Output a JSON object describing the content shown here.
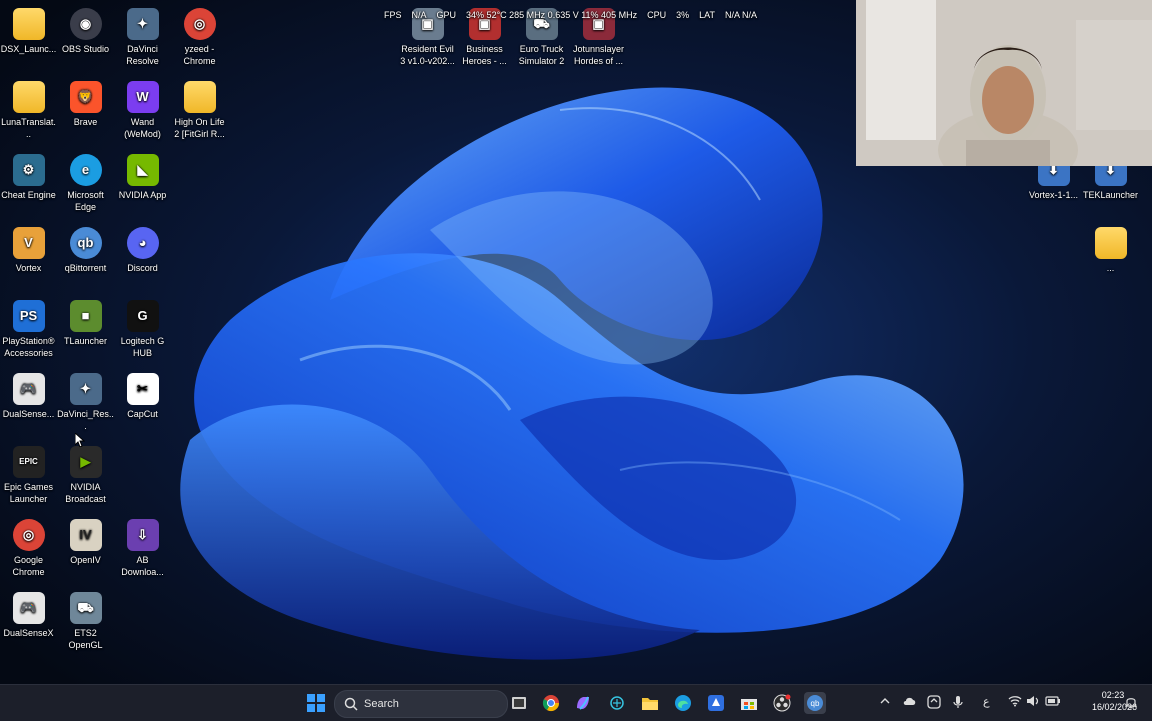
{
  "desktop": {
    "osd": {
      "fps_label": "FPS",
      "fps_value": "N/A",
      "gpu_label": "GPU",
      "gpu_value": "34% 52°C 285 MHz 0.635 V 11% 405 MHz",
      "cpu_label": "CPU",
      "cpu_value": "3%",
      "lat_label": "LAT",
      "lat_value": "N/A N/A"
    },
    "icons": [
      {
        "label": "DSX_Launc...",
        "icon": "folder-icon",
        "color": "#f2c33a"
      },
      {
        "label": "OBS Studio",
        "icon": "obs-icon",
        "color": "#3a3d4a"
      },
      {
        "label": "DaVinci Resolve",
        "icon": "davinci-resolve-icon",
        "color": "#4b6a8a"
      },
      {
        "label": "yzeed - Chrome",
        "icon": "chrome-icon",
        "color": "#db4437"
      },
      {
        "label": "Resident Evil 3 v1.0-v202...",
        "icon": "resident-evil-icon",
        "color": "#6a7c8f"
      },
      {
        "label": "Business Heroes - ...",
        "icon": "business-heroes-icon",
        "color": "#b22f2f"
      },
      {
        "label": "Euro Truck Simulator 2",
        "icon": "euro-truck-icon",
        "color": "#5a6e80"
      },
      {
        "label": "Jotunnslayer Hordes of ...",
        "icon": "jotunnslayer-icon",
        "color": "#8b2a3a"
      },
      {
        "label": "LunaTranslat...",
        "icon": "folder-icon",
        "color": "#f2c33a"
      },
      {
        "label": "Brave",
        "icon": "brave-icon",
        "color": "#fb542b"
      },
      {
        "label": "Wand (WeMod)",
        "icon": "wand-icon",
        "color": "#7b3df0"
      },
      {
        "label": "High On Life 2 [FitGirl R...",
        "icon": "folder-icon",
        "color": "#f2c33a"
      },
      {
        "label": "Cheat Engine",
        "icon": "cheat-engine-icon",
        "color": "#2b6c8f"
      },
      {
        "label": "Microsoft Edge",
        "icon": "edge-icon",
        "color": "#1b9de2"
      },
      {
        "label": "NVIDIA App",
        "icon": "nvidia-icon",
        "color": "#76b900"
      },
      {
        "label": "Vortex",
        "icon": "vortex-icon",
        "color": "#e8a13a"
      },
      {
        "label": "qBittorrent",
        "icon": "qbittorrent-icon",
        "color": "#4a8bd6"
      },
      {
        "label": "Discord",
        "icon": "discord-icon",
        "color": "#5865f2"
      },
      {
        "label": "PlayStation® Accessories",
        "icon": "playstation-icon",
        "color": "#1f6fd6"
      },
      {
        "label": "TLauncher",
        "icon": "tlauncher-icon",
        "color": "#5c8c2e"
      },
      {
        "label": "Logitech G HUB",
        "icon": "logitech-icon",
        "color": "#111111"
      },
      {
        "label": "DualSense...",
        "icon": "dualsense-icon",
        "color": "#e6e6e6"
      },
      {
        "label": "DaVinci_Res...",
        "icon": "davinci-resolve-icon",
        "color": "#4b6a8a"
      },
      {
        "label": "CapCut",
        "icon": "capcut-icon",
        "color": "#ffffff"
      },
      {
        "label": "Epic Games Launcher",
        "icon": "epic-games-icon",
        "color": "#222222"
      },
      {
        "label": "NVIDIA Broadcast",
        "icon": "nvidia-broadcast-icon",
        "color": "#2a2a2a"
      },
      {
        "label": "Google Chrome",
        "icon": "chrome-icon",
        "color": "#db4437"
      },
      {
        "label": "OpenIV",
        "icon": "openiv-icon",
        "color": "#d9d2c2"
      },
      {
        "label": "AB Downloa...",
        "icon": "ab-download-icon",
        "color": "#6b3fb0"
      },
      {
        "label": "DualSenseX",
        "icon": "dualsense-icon",
        "color": "#e6e6e6"
      },
      {
        "label": "ETS2 OpenGL",
        "icon": "ets2-icon",
        "color": "#6f8799"
      },
      {
        "label": "Vortex-1-1...",
        "icon": "installer-icon",
        "color": "#3b74c4"
      },
      {
        "label": "TEKLauncher",
        "icon": "installer-icon",
        "color": "#3b74c4"
      },
      {
        "label": "...",
        "icon": "folder-icon",
        "color": "#f2c33a"
      }
    ],
    "glyphs": {
      "folder": "",
      "obs": "◉",
      "davinci": "✦",
      "chrome": "◎",
      "brave": "🦁",
      "wand": "W",
      "cheat": "⚙",
      "edge": "e",
      "nvidia": "◣",
      "vortex": "V",
      "qbit": "qb",
      "discord": "◕",
      "ps": "PS",
      "tl": "■",
      "logi": "G",
      "ds": "🎮",
      "capcut": "✂",
      "epic": "EPIC",
      "broadcast": "▶",
      "openiv": "IV",
      "ab": "⇩",
      "ets": "⛟",
      "inst": "⬇",
      "game": "▣"
    }
  },
  "taskbar": {
    "search_label": "Search",
    "tray": {
      "keyboard": "ع"
    },
    "clock": {
      "time": "02:23",
      "date": "16/02/2026"
    },
    "icons": [
      "windows-start-icon",
      "search-icon",
      "task-view-icon",
      "chrome-icon",
      "copilot-icon",
      "cursor-app-icon",
      "file-explorer-icon",
      "edge-icon",
      "app-store-icon",
      "microsoft-store-icon",
      "obs-icon",
      "qbittorrent-icon"
    ]
  }
}
